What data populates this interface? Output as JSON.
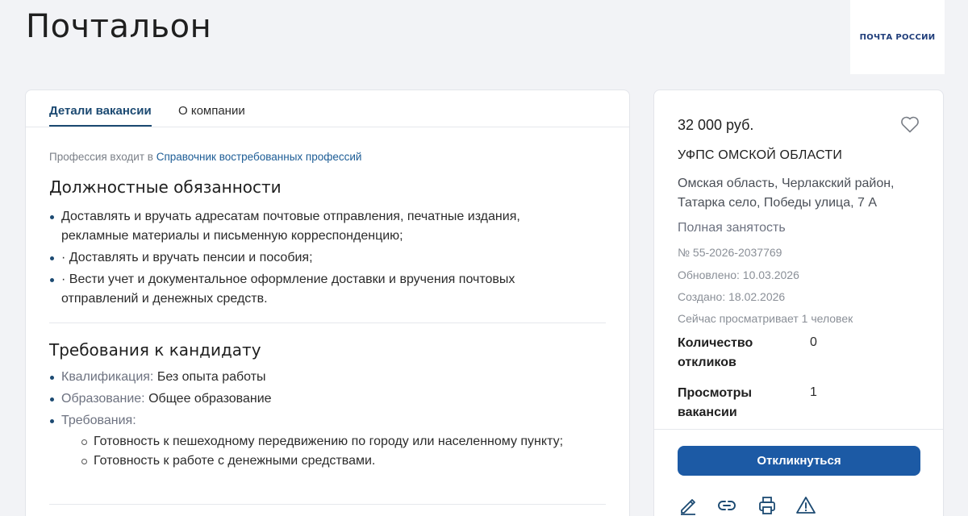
{
  "page": {
    "title": "Почтальон"
  },
  "logo": {
    "text": "ПОЧТА РОССИИ"
  },
  "tabs": [
    {
      "label": "Детали вакансии",
      "active": true
    },
    {
      "label": "О компании",
      "active": false
    }
  ],
  "profession": {
    "prefix": "Профессия входит в ",
    "link": "Справочник востребованных профессий"
  },
  "duties": {
    "title": "Должностные обязанности",
    "items": [
      "Доставлять и вручать адресатам почтовые отправления, печатные издания, рекламные материалы и письменную корреспонденцию;",
      "· Доставлять и вручать пенсии и пособия;",
      "· Вести учет и документальное оформление доставки и вручения почтовых отправлений и денежных средств."
    ]
  },
  "requirements": {
    "title": "Требования к кандидату",
    "qualification_label": "Квалификация:",
    "qualification_value": "Без опыта работы",
    "education_label": "Образование:",
    "education_value": "Общее образование",
    "reqs_label": "Требования:",
    "reqs": [
      "Готовность к пешеходному передвижению по городу или населенному пункту;",
      "Готовность к работе с денежными средствами."
    ]
  },
  "sidebar": {
    "salary": "32 000 руб.",
    "employer": "УФПС ОМСКОЙ ОБЛАСТИ",
    "address": "Омская область, Черлакский район, Татарка село, Победы улица, 7 А",
    "employment": "Полная занятость",
    "number": "№ 55-2026-2037769",
    "updated": "Обновлено: 10.03.2026",
    "created": "Создано: 18.02.2026",
    "viewing_now": "Сейчас просматривает 1 человек",
    "responses_label": "Количество откликов",
    "responses_value": "0",
    "views_label": "Просмотры вакансии",
    "views_value": "1",
    "respond_button": "Откликнуться"
  },
  "icons": {
    "favorite": "heart-icon",
    "actions": [
      "pencil-icon",
      "link-icon",
      "printer-icon",
      "warning-icon"
    ]
  },
  "colors": {
    "accent": "#1c4a72",
    "button": "#1c5aa5",
    "background": "#f2f3f6"
  }
}
